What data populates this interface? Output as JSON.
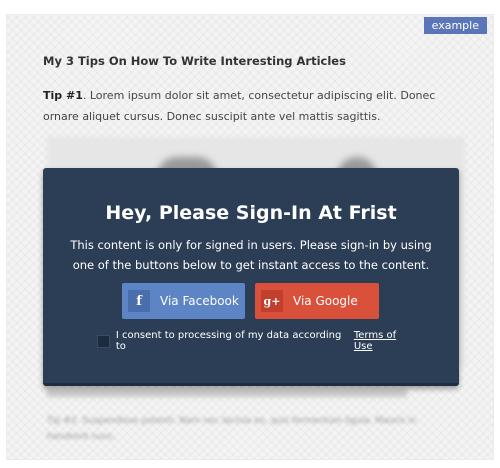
{
  "badge": "example",
  "article": {
    "title": "My 3 Tips On How To Write Interesting Articles",
    "tip1_label": "Tip #1",
    "tip1_text": ". Lorem ipsum dolor sit amet, consectetur adipiscing elit. Donec ornare aliquet cursus. Donec suscipit ante vel mattis sagittis.",
    "tip2_text": "Tip #2. Suspendisse potenti. Nam nec lacinia ex, quis fermentum ligula. Mauris in hendrerit nunc."
  },
  "signin": {
    "title": "Hey, Please Sign-In At Frist",
    "text": "This content is only for signed in users. Please sign-in by using one of the buttons below to get instant access to the content.",
    "facebook_label": "Via Facebook",
    "google_label": "Via Google",
    "facebook_icon": "f",
    "google_icon": "g+",
    "consent_text": "I consent to processing of my data according to",
    "terms_label": "Terms of Use"
  },
  "colors": {
    "overlay": "#2c3e55",
    "facebook": "#5d84c4",
    "google": "#d9503b",
    "badge": "#5a76b8"
  }
}
